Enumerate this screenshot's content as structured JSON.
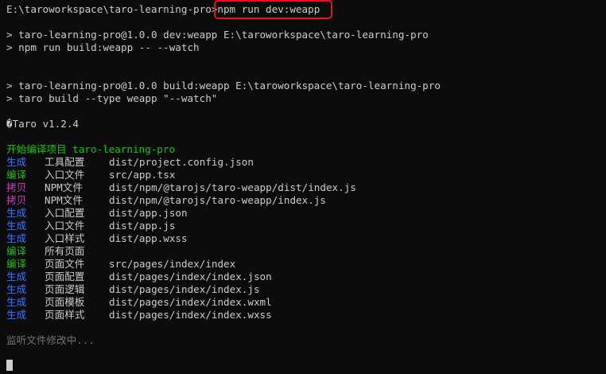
{
  "prompt": {
    "path": "E:\\taroworkspace\\taro-learning-pro>",
    "command": "npm run dev:weapp"
  },
  "script_echo": [
    "> taro-learning-pro@1.0.0 dev:weapp E:\\taroworkspace\\taro-learning-pro",
    "> npm run build:weapp -- --watch",
    "> taro-learning-pro@1.0.0 build:weapp E:\\taroworkspace\\taro-learning-pro",
    "> taro build --type weapp \"--watch\""
  ],
  "version_line": "�Taro v1.2.4",
  "compile_start": {
    "label": "开始编译项目",
    "project": "taro-learning-pro"
  },
  "build_rows": [
    {
      "label": "生成",
      "step": "工具配置",
      "path": "dist/project.config.json",
      "color": "#3b78ff"
    },
    {
      "label": "编译",
      "step": "入口文件",
      "path": "src/app.tsx",
      "color": "#16c60c"
    },
    {
      "label": "拷贝",
      "step": "NPM文件",
      "path": "dist/npm/@tarojs/taro-weapp/dist/index.js",
      "color": "#c63ab7"
    },
    {
      "label": "拷贝",
      "step": "NPM文件",
      "path": "dist/npm/@tarojs/taro-weapp/index.js",
      "color": "#c63ab7"
    },
    {
      "label": "生成",
      "step": "入口配置",
      "path": "dist/app.json",
      "color": "#3b78ff"
    },
    {
      "label": "生成",
      "step": "入口文件",
      "path": "dist/app.js",
      "color": "#3b78ff"
    },
    {
      "label": "生成",
      "step": "入口样式",
      "path": "dist/app.wxss",
      "color": "#3b78ff"
    },
    {
      "label": "编译",
      "step": "所有页面",
      "path": "",
      "color": "#16c60c"
    },
    {
      "label": "编译",
      "step": "页面文件",
      "path": "src/pages/index/index",
      "color": "#16c60c"
    },
    {
      "label": "生成",
      "step": "页面配置",
      "path": "dist/pages/index/index.json",
      "color": "#3b78ff"
    },
    {
      "label": "生成",
      "step": "页面逻辑",
      "path": "dist/pages/index/index.js",
      "color": "#3b78ff"
    },
    {
      "label": "生成",
      "step": "页面模板",
      "path": "dist/pages/index/index.wxml",
      "color": "#3b78ff"
    },
    {
      "label": "生成",
      "step": "页面样式",
      "path": "dist/pages/index/index.wxss",
      "color": "#3b78ff"
    }
  ],
  "watch_status": "监听文件修改中...",
  "colors": {
    "background": "#0c0c0c",
    "text": "#cccccc",
    "highlight_box": "#e81123",
    "green": "#16c60c",
    "blue": "#3b78ff",
    "magenta": "#c63ab7",
    "muted": "#767676"
  }
}
